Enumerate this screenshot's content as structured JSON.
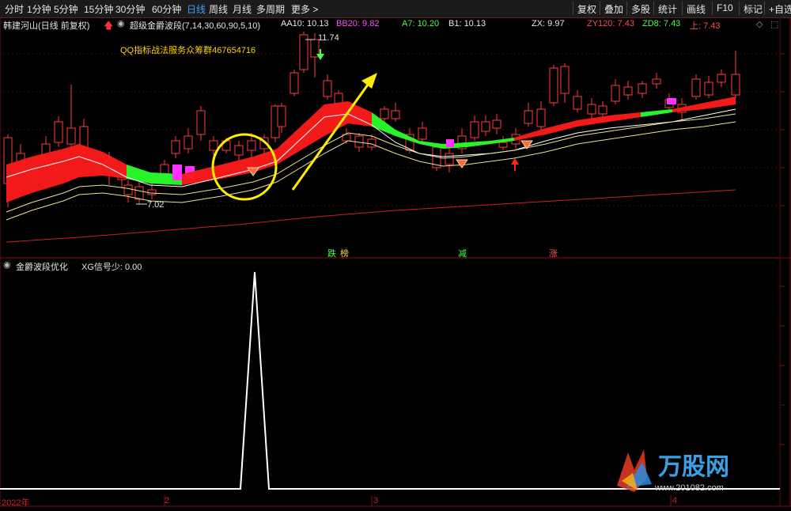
{
  "toolbar": {
    "periods": [
      "分时",
      "1分钟",
      "5分钟",
      "15分钟",
      "30分钟",
      "60分钟",
      "日线",
      "周线",
      "月线",
      "多周期",
      "更多 >"
    ],
    "active_period": "日线",
    "right_buttons": [
      "复权",
      "叠加",
      "多股",
      "统计",
      "画线",
      "F10",
      "标记",
      "+自选"
    ]
  },
  "header": {
    "stock_name": "韩建河山(日线 前复权)",
    "indicator": "超级金爵波段(7,14,30,60,90,5,10)",
    "values": [
      {
        "label": "AA10: 10.13",
        "color": "#e6e6e6"
      },
      {
        "label": "BB20: 9.82",
        "color": "#ff4cff"
      },
      {
        "label": "A7: 10.20",
        "color": "#49ff49"
      },
      {
        "label": "B1: 10.13",
        "color": "#e6e6e6"
      },
      {
        "label": "ZX: 9.97",
        "color": "#e6e6e6"
      },
      {
        "label": "ZY120: 7.43",
        "color": "#ff4d4d"
      },
      {
        "label": "ZD8: 7.43",
        "color": "#49ff49"
      },
      {
        "label": "上: 7.43",
        "color": "#ff4d4d"
      }
    ]
  },
  "main_chart": {
    "ad_text": "QQ指标战法服务众筹群467654716",
    "high_label": "11.74",
    "low_label": "7.02",
    "signal_labels": [
      {
        "text": "跌",
        "color": "#49ff49"
      },
      {
        "text": "榜",
        "color": "#ffd24d"
      },
      {
        "text": "减",
        "color": "#49ff49"
      },
      {
        "text": "涨",
        "color": "#ff4d4d"
      }
    ]
  },
  "sub_chart": {
    "title": "金爵波段优化",
    "signal_label": "XG信号少: 0.00"
  },
  "x_axis": {
    "labels": [
      "2022年",
      "2",
      "3",
      "4"
    ]
  },
  "watermark": {
    "brand": "万股网",
    "url": "www.201082.com"
  },
  "chart_data": {
    "type": "candlestick",
    "series_name": "韩建河山",
    "price_markers": {
      "high": 11.74,
      "low": 7.02
    },
    "xg_signal": {
      "name": "XG信号少",
      "last_value": 0.0,
      "spike_count": 1
    },
    "colors": {
      "up": "#ff3a3a",
      "down": "#2fe02f",
      "ribbon_up": "#ff1a1a",
      "ribbon_down": "#2aff2a",
      "ribbon_mix": "#ff33ff",
      "ma120": "#cc1f1f"
    }
  }
}
